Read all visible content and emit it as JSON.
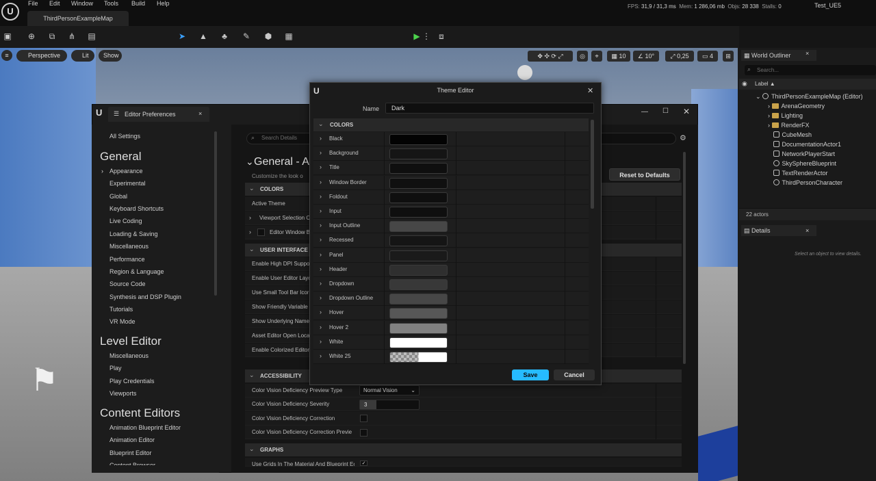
{
  "menu": [
    "File",
    "Edit",
    "Window",
    "Tools",
    "Build",
    "Help"
  ],
  "map_tab": "ThirdPersonExampleMap",
  "stats": {
    "fps_label": "FPS:",
    "fps": "31,9",
    "ms": "/ 31,3 ms",
    "mem_label": "Mem:",
    "mem": "1 286,06 mb",
    "objs_label": "Objs:",
    "objs": "28 338",
    "stalls_label": "Stalls:",
    "stalls": "0"
  },
  "project": "Test_UE5",
  "viewport": {
    "perspective": "Perspective",
    "lit": "Lit",
    "show": "Show",
    "grid": "10",
    "angle": "10°",
    "scale": "0,25",
    "cam": "4"
  },
  "outliner": {
    "title": "World Outliner",
    "search_placeholder": "Search...",
    "label_header": "Label ▲",
    "root": "ThirdPersonExampleMap (Editor)",
    "items": [
      "ArenaGeometry",
      "Lighting",
      "RenderFX",
      "CubeMesh",
      "DocumentationActor1",
      "NetworkPlayerStart",
      "SkySphereBlueprint",
      "TextRenderActor",
      "ThirdPersonCharacter"
    ],
    "count": "22 actors",
    "details_title": "Details",
    "details_empty": "Select an object to view details."
  },
  "prefs": {
    "title": "Editor Preferences",
    "all_settings": "All Settings",
    "general_head": "General",
    "general_items": [
      "Appearance",
      "Experimental",
      "Global",
      "Keyboard Shortcuts",
      "Live Coding",
      "Loading & Saving",
      "Miscellaneous",
      "Performance",
      "Region & Language",
      "Source Code",
      "Synthesis and DSP Plugin",
      "Tutorials",
      "VR Mode"
    ],
    "level_head": "Level Editor",
    "level_items": [
      "Miscellaneous",
      "Play",
      "Play Credentials",
      "Viewports"
    ],
    "content_head": "Content Editors",
    "content_items": [
      "Animation Blueprint Editor",
      "Animation Editor",
      "Blueprint Editor",
      "Content Browser"
    ],
    "search_placeholder": "Search Details",
    "section_title": "General - A",
    "section_desc": "Customize the look o",
    "reset": "Reset to Defaults",
    "colors_sec": "COLORS",
    "colors_rows": [
      "Active Theme",
      "Viewport Selection C",
      "Editor Window Ba"
    ],
    "ui_sec": "USER INTERFACE",
    "ui_rows": [
      "Enable High DPI Suppor",
      "Enable User Editor Layo",
      "Use Small Tool Bar Icor",
      "Show Friendly Variable",
      "Show Underlying Names",
      "Asset Editor Open Loca",
      "Enable Colorized Editor"
    ],
    "acc_sec": "ACCESSIBILITY",
    "acc_rows": [
      "Color Vision Deficiency Preview Type",
      "Color Vision Deficiency Severity",
      "Color Vision Deficiency Correction",
      "Color Vision Deficiency Correction Previe"
    ],
    "vision_type": "Normal Vision",
    "severity": "3",
    "graphs_sec": "GRAPHS",
    "graphs_rows": [
      "Use Grids In The Material And Blueprint Ec"
    ]
  },
  "theme": {
    "title": "Theme Editor",
    "name_label": "Name",
    "name_value": "Dark",
    "colors_sec": "COLORS",
    "rows": [
      {
        "label": "Black",
        "color": "#030303"
      },
      {
        "label": "Background",
        "color": "#151515"
      },
      {
        "label": "Title",
        "color": "#0f0f0f"
      },
      {
        "label": "Window Border",
        "color": "#101010"
      },
      {
        "label": "Foldout",
        "color": "#0f0f0f"
      },
      {
        "label": "Input",
        "color": "#0f0f0f"
      },
      {
        "label": "Input Outline",
        "color": "#474747"
      },
      {
        "label": "Recessed",
        "color": "#151515"
      },
      {
        "label": "Panel",
        "color": "#1a1a1a"
      },
      {
        "label": "Header",
        "color": "#2f2f2f"
      },
      {
        "label": "Dropdown",
        "color": "#383838"
      },
      {
        "label": "Dropdown Outline",
        "color": "#474747"
      },
      {
        "label": "Hover",
        "color": "#575757"
      },
      {
        "label": "Hover 2",
        "color": "#818181"
      },
      {
        "label": "White",
        "color": "#ffffff"
      },
      {
        "label": "White 25",
        "color": "#ffffff"
      }
    ],
    "save": "Save",
    "cancel": "Cancel",
    "accent": "#26bbff"
  }
}
